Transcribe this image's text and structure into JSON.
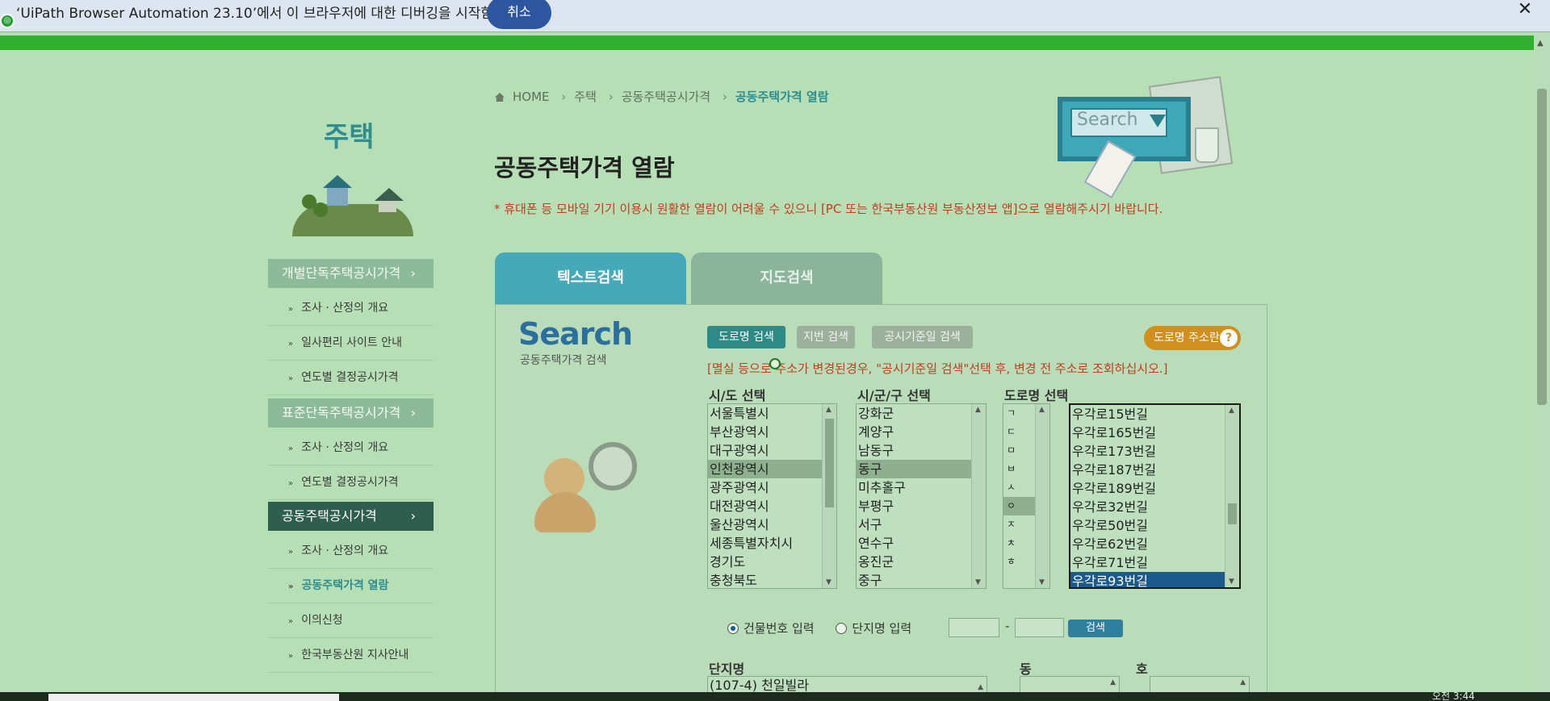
{
  "debug_bar": {
    "message": "‘UiPath Browser Automation 23.10’에서 이 브라우저에 대한 디버깅을 시작함",
    "cancel_label": "취소",
    "close_label": "✕",
    "target_icon": "◎"
  },
  "sidebar": {
    "title": "주택",
    "groups": [
      {
        "label": "개별단독주택공시가격",
        "items": [
          "조사 · 산정의 개요",
          "일사편리 사이트 안내",
          "연도별 결정공시가격"
        ]
      },
      {
        "label": "표준단독주택공시가격",
        "items": [
          "조사 · 산정의 개요",
          "연도별 결정공시가격"
        ]
      },
      {
        "label": "공동주택공시가격",
        "items": [
          "조사 · 산정의 개요",
          "공동주택가격 열람",
          "이의신청",
          "한국부동산원 지사안내"
        ]
      }
    ],
    "chevron": "›",
    "bullet": "»"
  },
  "breadcrumb": {
    "home": "HOME",
    "items": [
      "주택",
      "공동주택공시가격"
    ],
    "current": "공동주택가격 열람",
    "separator": "›"
  },
  "page": {
    "title": "공동주택가격 열람",
    "notice": "* 휴대폰 등 모바일 기기 이용시 원활한 열람이 어려울 수 있으니 [PC 또는 한국부동산원 부동산정보 앱]으로 열람해주시기 바랍니다.",
    "hero_search_text": "Search"
  },
  "tabs": {
    "text_search": "텍스트검색",
    "map_search": "지도검색"
  },
  "search_panel": {
    "logo": "Search",
    "logo_sub": "공동주택가격 검색",
    "buttons": {
      "road": "도로명 검색",
      "lot": "지번 검색",
      "date": "공시기준일 검색",
      "guide": "도로명 주소란",
      "guide_icon": "?"
    },
    "hint": "[멸실 등으로 주소가 변경된경우, \"공시기준일 검색\"선택 후, 변경 전 주소로 조회하십시오.]",
    "labels": {
      "sido": "시/도 선택",
      "sigungu": "시/군/구 선택",
      "road": "도로명 선택"
    },
    "sido_options": [
      "서울특별시",
      "부산광역시",
      "대구광역시",
      "인천광역시",
      "광주광역시",
      "대전광역시",
      "울산광역시",
      "세종특별자치시",
      "경기도",
      "충청북도"
    ],
    "sido_selected": 3,
    "sigungu_options": [
      "강화군",
      "계양구",
      "남동구",
      "동구",
      "미추홀구",
      "부평구",
      "서구",
      "연수구",
      "옹진군",
      "중구"
    ],
    "sigungu_selected": 3,
    "initial_options": [
      "ㄱ",
      "ㄷ",
      "ㅁ",
      "ㅂ",
      "ㅅ",
      "ㅇ",
      "ㅈ",
      "ㅊ",
      "ㅎ"
    ],
    "initial_selected": 5,
    "road_options": [
      "우각로15번길",
      "우각로165번길",
      "우각로173번길",
      "우각로187번길",
      "우각로189번길",
      "우각로32번길",
      "우각로50번길",
      "우각로62번길",
      "우각로71번길",
      "우각로93번길"
    ],
    "road_selected": 9,
    "radio_building": "건물번호 입력",
    "radio_complex": "단지명 입력",
    "dash": "-",
    "search_label": "검색",
    "complex_label": "단지명",
    "dong_label": "동",
    "ho_label": "호",
    "complex_first": "(107-4) 천일빌라"
  },
  "taskbar": {
    "clock": "오전 3:44"
  }
}
